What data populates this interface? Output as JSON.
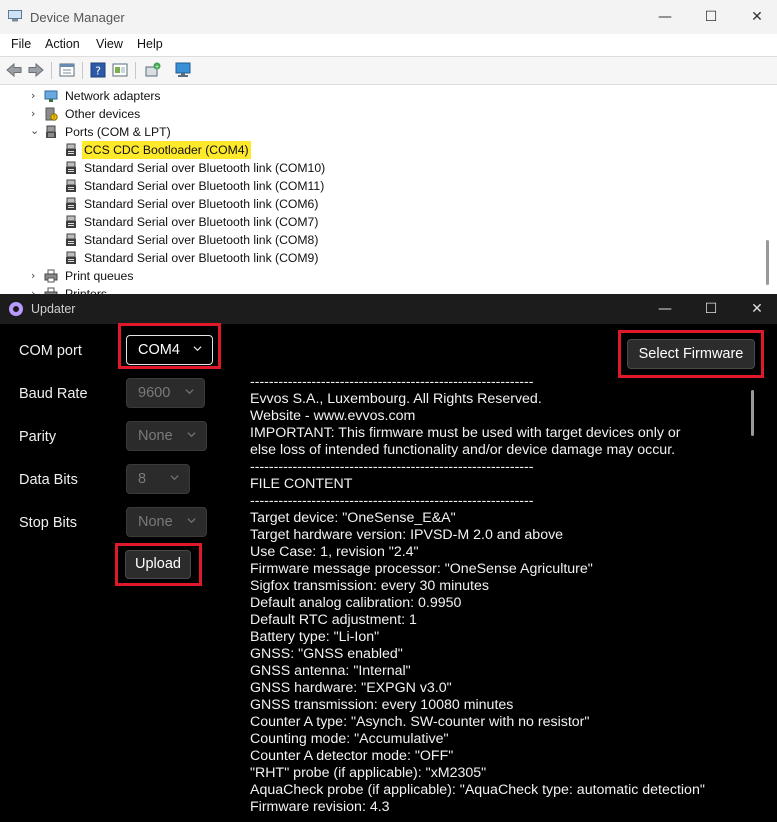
{
  "device_manager": {
    "title": "Device Manager",
    "window_controls": {
      "minimize": "—",
      "maximize": "☐",
      "close": "✕"
    },
    "menu": [
      "File",
      "Action",
      "View",
      "Help"
    ],
    "tree": [
      {
        "label": "Network adapters",
        "expanded": false,
        "icon": "network-adapter-icon"
      },
      {
        "label": "Other devices",
        "expanded": false,
        "icon": "unknown-device-icon"
      },
      {
        "label": "Ports (COM & LPT)",
        "expanded": true,
        "icon": "port-icon"
      },
      {
        "label": "CCS CDC Bootloader (COM4)",
        "child": true,
        "highlighted": true,
        "icon": "port-device-icon"
      },
      {
        "label": "Standard Serial over Bluetooth link (COM10)",
        "child": true,
        "icon": "port-device-icon"
      },
      {
        "label": "Standard Serial over Bluetooth link (COM11)",
        "child": true,
        "icon": "port-device-icon"
      },
      {
        "label": "Standard Serial over Bluetooth link (COM6)",
        "child": true,
        "icon": "port-device-icon"
      },
      {
        "label": "Standard Serial over Bluetooth link (COM7)",
        "child": true,
        "icon": "port-device-icon"
      },
      {
        "label": "Standard Serial over Bluetooth link (COM8)",
        "child": true,
        "icon": "port-device-icon"
      },
      {
        "label": "Standard Serial over Bluetooth link (COM9)",
        "child": true,
        "icon": "port-device-icon"
      },
      {
        "label": "Print queues",
        "expanded": false,
        "icon": "printer-icon"
      },
      {
        "label": "Printers",
        "expanded": false,
        "icon": "printer-icon"
      }
    ],
    "highlight_color": "#ffe92b"
  },
  "updater": {
    "title": "Updater",
    "window_controls": {
      "minimize": "—",
      "maximize": "☐",
      "close": "✕"
    },
    "com_port": {
      "label": "COM port",
      "value": "COM4"
    },
    "baud_rate": {
      "label": "Baud Rate",
      "value": "9600"
    },
    "parity": {
      "label": "Parity",
      "value": "None"
    },
    "data_bits": {
      "label": "Data Bits",
      "value": "8"
    },
    "stop_bits": {
      "label": "Stop Bits",
      "value": "None"
    },
    "upload_label": "Upload",
    "select_firmware_label": "Select Firmware",
    "highlight_box_color": "#e0192a",
    "content_lines": [
      "------------------------------------------------------------",
      "Evvos S.A., Luxembourg. All Rights Reserved.",
      "Website - www.evvos.com",
      "IMPORTANT:  This firmware must be used with target devices only or",
      "else loss of intended functionality and/or device damage may occur.",
      "------------------------------------------------------------",
      "FILE CONTENT",
      "------------------------------------------------------------",
      "Target device:  \"OneSense_E&A\"",
      "Target hardware version: IPVSD-M 2.0 and above",
      "Use Case: 1, revision  \"2.4\"",
      "Firmware message processor:  \"OneSense Agriculture\"",
      "Sigfox transmission: every 30     minutes",
      "Default analog calibration: 0.9950",
      "Default RTC adjustment: 1",
      "Battery type:  \"Li-Ion\"",
      "GNSS:     \"GNSS enabled\"",
      "GNSS antenna:  \"Internal\"",
      "GNSS hardware:      \"EXPGN v3.0\"",
      "GNSS transmission: every 10080      minutes",
      "Counter A type:  \"Asynch. SW-counter with no resistor\"",
      "Counting mode:  \"Accumulative\"",
      "Counter A detector mode:  \"OFF\"",
      "\"RHT\" probe (if applicable):  \"xM2305\"",
      "AquaCheck probe (if applicable):  \"AquaCheck type: automatic detection\"",
      "Firmware revision: 4.3"
    ]
  }
}
